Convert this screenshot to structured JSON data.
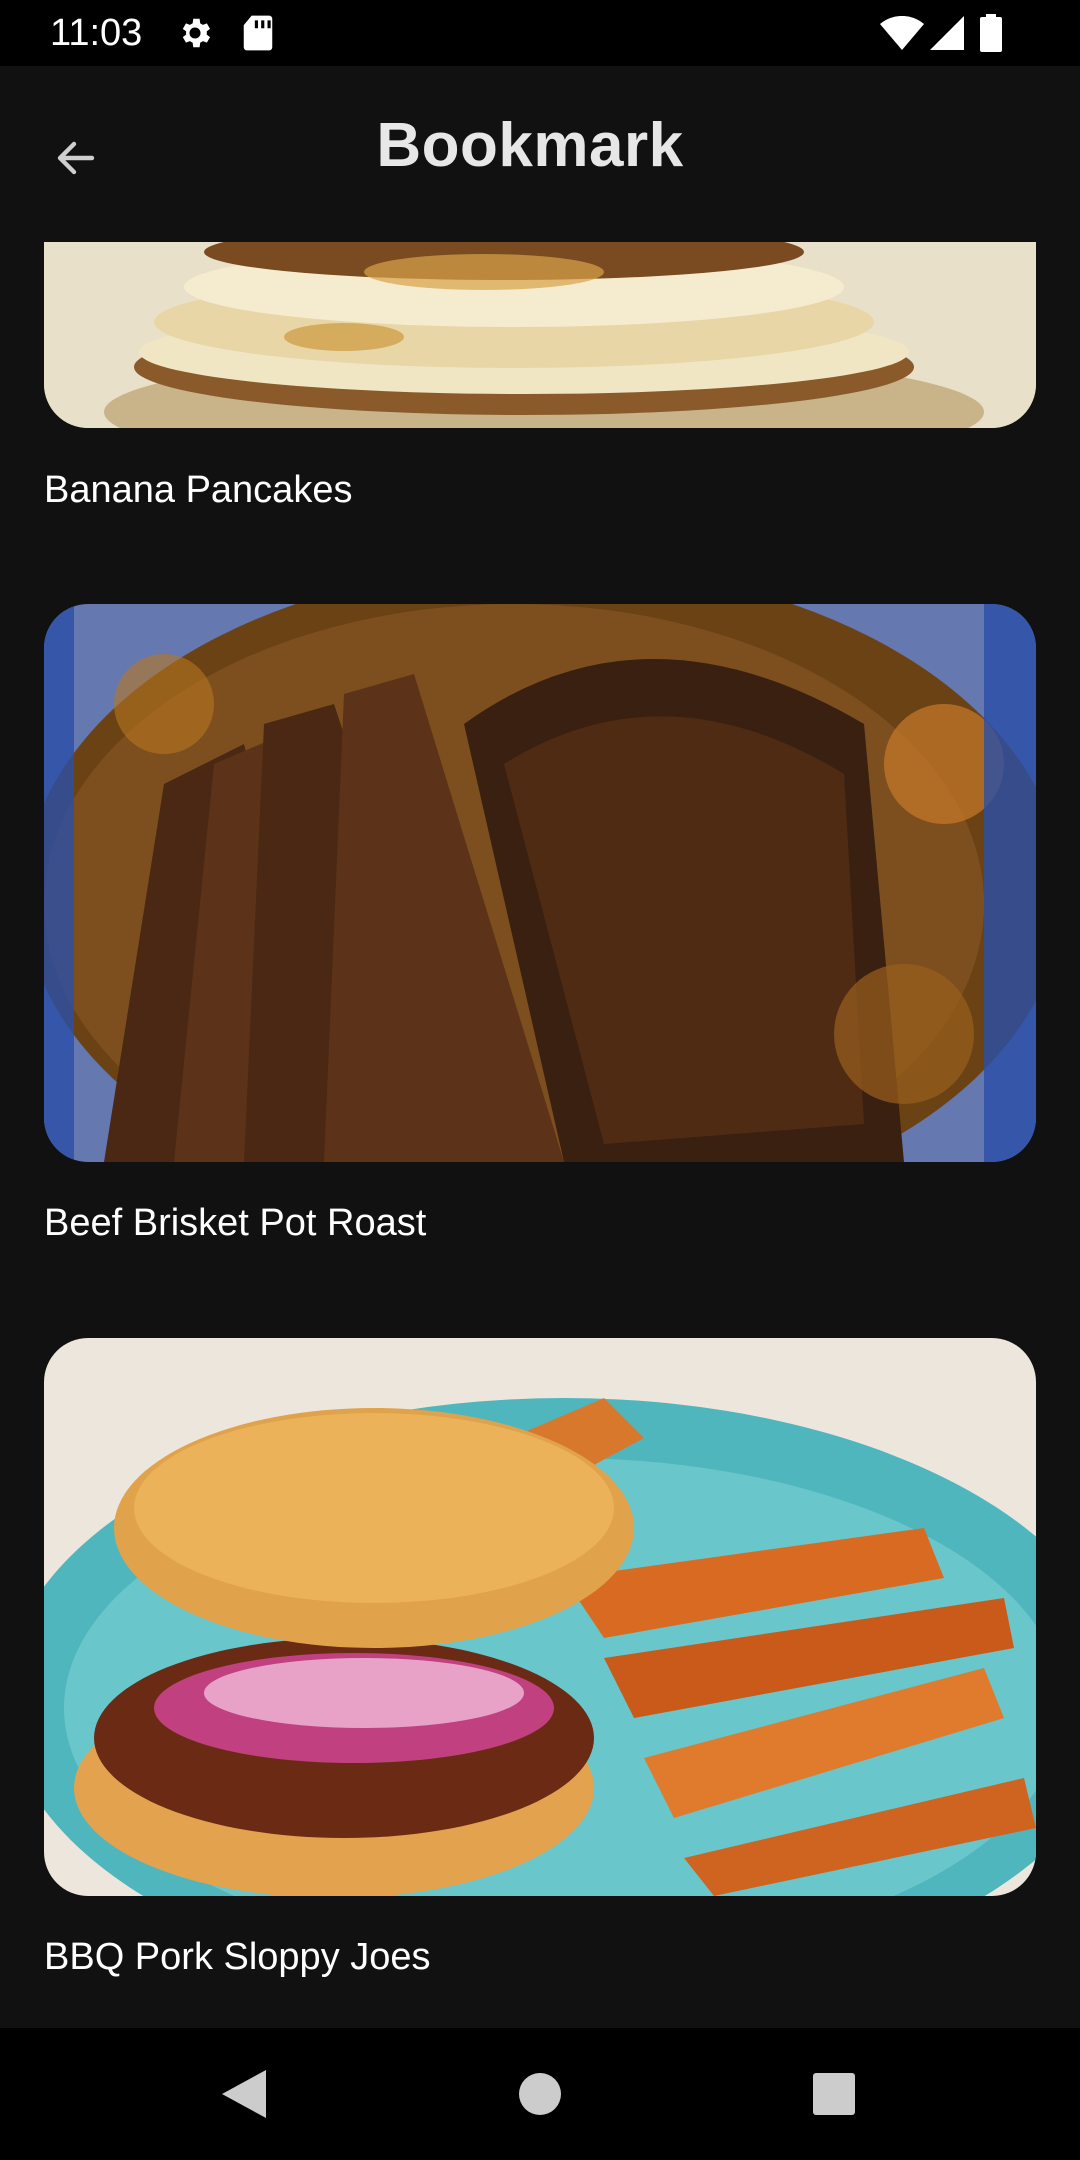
{
  "status_bar": {
    "time": "11:03",
    "icons_left": [
      "gear-icon",
      "sd-card-icon"
    ],
    "icons_right": [
      "wifi-icon",
      "signal-icon",
      "battery-icon"
    ]
  },
  "app_bar": {
    "title": "Bookmark",
    "back_icon": "arrow-left-icon"
  },
  "bookmarks": [
    {
      "title": "Banana Pancakes",
      "image": "banana-pancakes-photo"
    },
    {
      "title": "Beef Brisket Pot Roast",
      "image": "beef-brisket-photo"
    },
    {
      "title": "BBQ Pork Sloppy Joes",
      "image": "sloppy-joes-photo"
    }
  ],
  "nav_bar": {
    "back": "triangle-back-icon",
    "home": "circle-home-icon",
    "recents": "square-recents-icon"
  },
  "colors": {
    "background": "#111111",
    "system_bar": "#000000",
    "title_text": "#e7e7e7",
    "item_text": "#ffffff"
  }
}
